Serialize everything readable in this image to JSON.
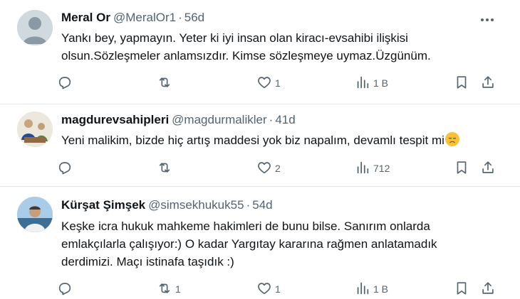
{
  "tweets": [
    {
      "name": "Meral Or",
      "handle": "@MeralOr1",
      "sep": "·",
      "time": "56d",
      "lines": [
        "Yankı bey, yapmayın. Yeter ki iyi insan olan kiracı-evsahibi ilişkisi",
        "olsun.Sözleşmeler anlamsızdır. Kimse sözleşmeye uymaz.Üzgünüm."
      ],
      "replies": "",
      "retweets": "",
      "likes": "1",
      "views": "1 B"
    },
    {
      "name": "magdurevsahipleri",
      "handle": "@magdurmalikler",
      "sep": "·",
      "time": "41d",
      "lines": [
        "Yeni malikim, bizde hiç artış maddesi yok biz napalım, devamlı tespit mi"
      ],
      "emoji": "disappointed-face",
      "replies": "",
      "retweets": "",
      "likes": "2",
      "views": "712"
    },
    {
      "name": "Kürşat Şimşek",
      "handle": "@simsekhukuk55",
      "sep": "·",
      "time": "54d",
      "lines": [
        "Keşke icra hukuk mahkeme hakimleri de bunu bilse. Sanırım onlarda",
        "emlakçılarla çalışıyor:) O kadar Yargıtay kararına rağmen anlatamadık",
        "derdimizi. Maçı istinafa taşıdık :)"
      ],
      "replies": "",
      "retweets": "1",
      "likes": "1",
      "views": "1 B"
    }
  ],
  "icons": {
    "more": "more-icon",
    "reply": "reply-icon",
    "retweet": "retweet-icon",
    "like": "heart-icon",
    "views": "views-icon",
    "bookmark": "bookmark-icon",
    "share": "share-icon"
  },
  "colors": {
    "text": "#0f1419",
    "secondary": "#536471",
    "divider": "#e6e9eb"
  }
}
